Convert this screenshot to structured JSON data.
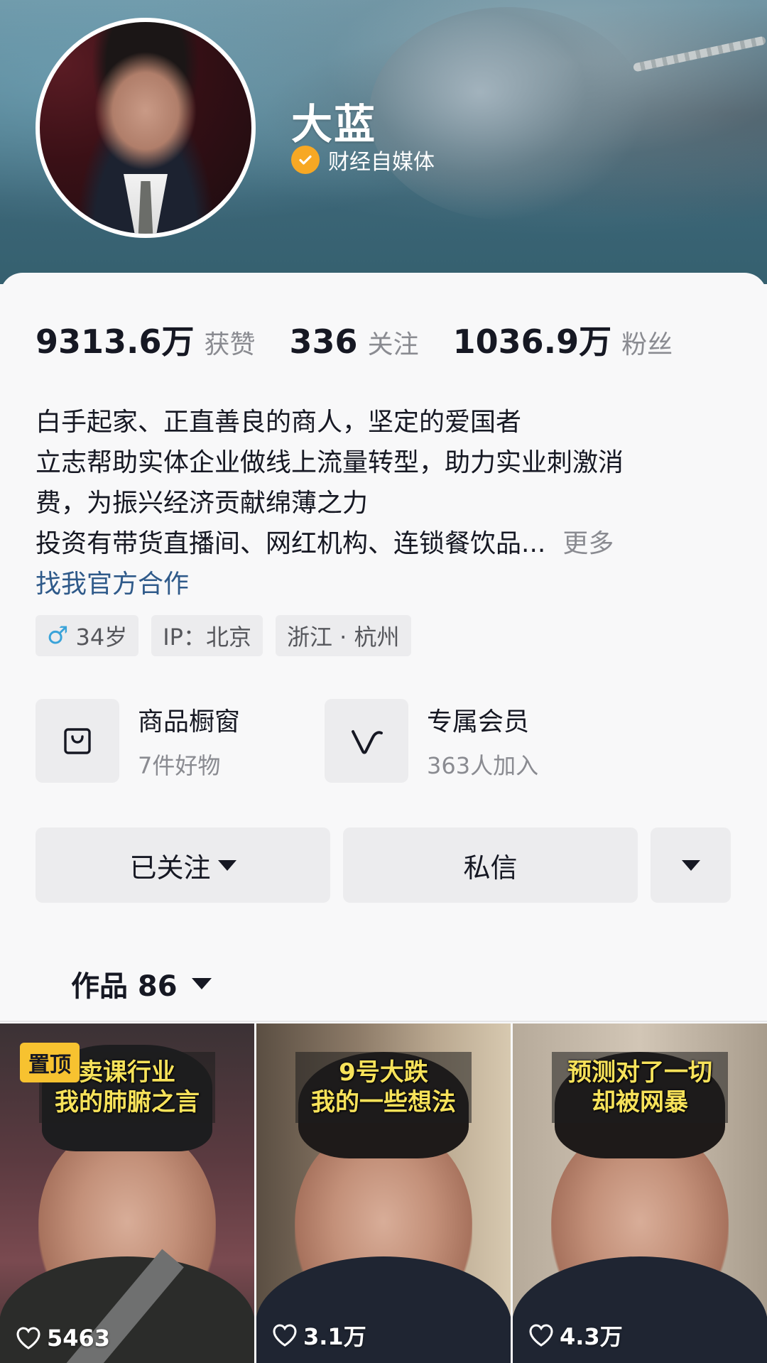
{
  "profile": {
    "name": "大蓝",
    "verified_label": "财经自媒体"
  },
  "stats": [
    {
      "value": "9313.6万",
      "label": "获赞"
    },
    {
      "value": "336",
      "label": "关注"
    },
    {
      "value": "1036.9万",
      "label": "粉丝"
    }
  ],
  "bio": {
    "lines": [
      "白手起家、正直善良的商人，坚定的爱国者",
      "立志帮助实体企业做线上流量转型，助力实业刺激消",
      "费，为振兴经济贡献绵薄之力",
      "投资有带货直播间、网红机构、连锁餐饮品..."
    ],
    "more_label": "更多",
    "cooperation_link": "找我官方合作"
  },
  "tags": {
    "gender_icon": "male-icon",
    "age": "34岁",
    "ip": "IP：北京",
    "location": "浙江 · 杭州"
  },
  "features": [
    {
      "icon": "shopping-bag-icon",
      "title": "商品橱窗",
      "subtitle": "7件好物"
    },
    {
      "icon": "v-membership-icon",
      "title": "专属会员",
      "subtitle": "363人加入"
    }
  ],
  "actions": {
    "follow_label": "已关注",
    "message_label": "私信"
  },
  "works": {
    "label": "作品 86"
  },
  "videos": [
    {
      "pinned_label": "置顶",
      "caption_line1": "卖课行业",
      "caption_line2": "我的肺腑之言",
      "likes": "5463"
    },
    {
      "caption_line1": "9号大跌",
      "caption_line2": "我的一些想法",
      "likes": "3.1万"
    },
    {
      "caption_line1": "预测对了一切",
      "caption_line2": "却被网暴",
      "likes": "4.3万"
    }
  ]
}
